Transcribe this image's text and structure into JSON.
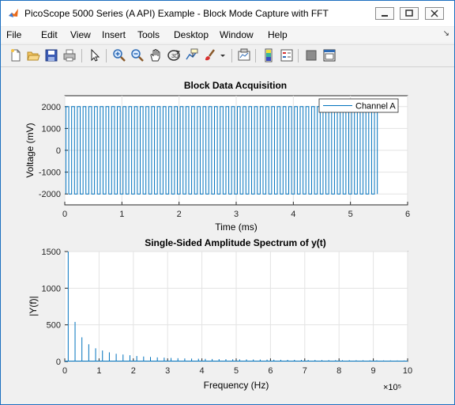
{
  "window": {
    "title": "PicoScope 5000 Series (A API) Example - Block Mode Capture with FFT"
  },
  "menu": [
    "File",
    "Edit",
    "View",
    "Insert",
    "Tools",
    "Desktop",
    "Window",
    "Help"
  ],
  "toolbar_icons": [
    "new-figure-icon",
    "open-file-icon",
    "save-icon",
    "print-icon",
    "pointer-icon",
    "zoom-in-icon",
    "zoom-out-icon",
    "pan-icon",
    "rotate-3d-icon",
    "data-cursor-icon",
    "brush-icon",
    "link-plot-icon",
    "colorbar-icon",
    "legend-icon",
    "hide-plot-tools-icon",
    "show-plot-tools-icon"
  ],
  "colors": {
    "line": "#0072bd",
    "titlebar_border": "#1c6fbf"
  },
  "chart_data": [
    {
      "type": "line",
      "title": "Block Data Acquisition",
      "xlabel": "Time (ms)",
      "ylabel": "Voltage (mV)",
      "xlim": [
        0,
        6
      ],
      "ylim": [
        -2500,
        2500
      ],
      "xticks": [
        "0",
        "1",
        "2",
        "3",
        "4",
        "5",
        "6"
      ],
      "yticks": [
        "2000",
        "1000",
        "0",
        "-1000",
        "-2000"
      ],
      "grid": true,
      "legend": {
        "position": "top-right",
        "entries": [
          "Channel A"
        ]
      },
      "series": [
        {
          "name": "Channel A",
          "waveform": "square",
          "high": 2000,
          "low": -2000,
          "frequency_khz": 10,
          "start_ms": 0.02,
          "end_ms": 5.5
        }
      ]
    },
    {
      "type": "line",
      "title": "Single-Sided Amplitude Spectrum of y(t)",
      "xlabel": "Frequency (Hz)",
      "ylabel": "|Y(f)|",
      "xlim": [
        0,
        10
      ],
      "x_multiplier": "×10⁵",
      "ylim": [
        0,
        1500
      ],
      "xticks": [
        "0",
        "1",
        "2",
        "3",
        "4",
        "5",
        "6",
        "7",
        "8",
        "9",
        "10"
      ],
      "yticks": [
        "1500",
        "1000",
        "500",
        "0"
      ],
      "grid": true,
      "series": [
        {
          "harmonics": [
            [
              0.1,
              1500
            ],
            [
              0.3,
              540
            ],
            [
              0.5,
              330
            ],
            [
              0.7,
              235
            ],
            [
              0.9,
              180
            ],
            [
              1.1,
              150
            ],
            [
              1.3,
              125
            ],
            [
              1.5,
              105
            ],
            [
              1.7,
              95
            ],
            [
              1.9,
              85
            ],
            [
              2.1,
              75
            ],
            [
              2.3,
              68
            ],
            [
              2.5,
              62
            ],
            [
              2.7,
              56
            ],
            [
              2.9,
              52
            ],
            [
              3.1,
              48
            ],
            [
              3.3,
              45
            ],
            [
              3.5,
              42
            ],
            [
              3.7,
              40
            ],
            [
              3.9,
              38
            ],
            [
              4.1,
              36
            ],
            [
              4.3,
              34
            ],
            [
              4.5,
              32
            ],
            [
              4.7,
              31
            ],
            [
              4.9,
              30
            ],
            [
              5.1,
              29
            ],
            [
              5.3,
              28
            ],
            [
              5.5,
              27
            ],
            [
              5.7,
              26
            ],
            [
              5.9,
              25
            ],
            [
              6.1,
              24
            ],
            [
              6.3,
              23
            ],
            [
              6.5,
              22
            ],
            [
              6.7,
              22
            ],
            [
              6.9,
              21
            ],
            [
              7.1,
              20
            ],
            [
              7.3,
              20
            ],
            [
              7.5,
              19
            ],
            [
              7.7,
              18
            ],
            [
              7.9,
              18
            ],
            [
              8.1,
              17
            ],
            [
              8.3,
              17
            ],
            [
              8.5,
              16
            ],
            [
              8.7,
              16
            ],
            [
              8.9,
              15
            ],
            [
              9.1,
              15
            ],
            [
              9.3,
              14
            ],
            [
              9.5,
              14
            ],
            [
              9.7,
              13
            ],
            [
              9.9,
              13
            ]
          ]
        }
      ]
    }
  ]
}
